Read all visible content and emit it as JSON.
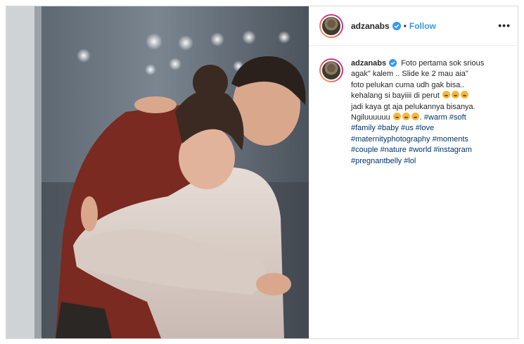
{
  "post": {
    "username": "adzanabs",
    "follow_label": "Follow",
    "separator": "•",
    "more_label": "•••",
    "caption": {
      "line1": "Foto pertama sok srious",
      "line2": "agak\" kalem .. Slide ke 2 mau aia\"",
      "line3": "foto pelukan cuma udh gak bisa..",
      "line4": "kehalang si bayiiii di perut",
      "line5": "jadi kaya gt aja pelukannya bisanya.",
      "line6": "Ngiluuuuuu"
    },
    "hashtags": [
      "#warm",
      "#soft",
      "#family",
      "#baby",
      "#us",
      "#love",
      "#maternityphotography",
      "#moments",
      "#couple",
      "#nature",
      "#world",
      "#instagram",
      "#pregnantbelly",
      "#lol"
    ]
  },
  "colors": {
    "follow": "#3897f0",
    "hashtag": "#003569",
    "verified": "#3897f0",
    "border": "#dbdbdb"
  },
  "icons": {
    "verified": "verified-badge-icon",
    "more": "more-options-icon"
  }
}
